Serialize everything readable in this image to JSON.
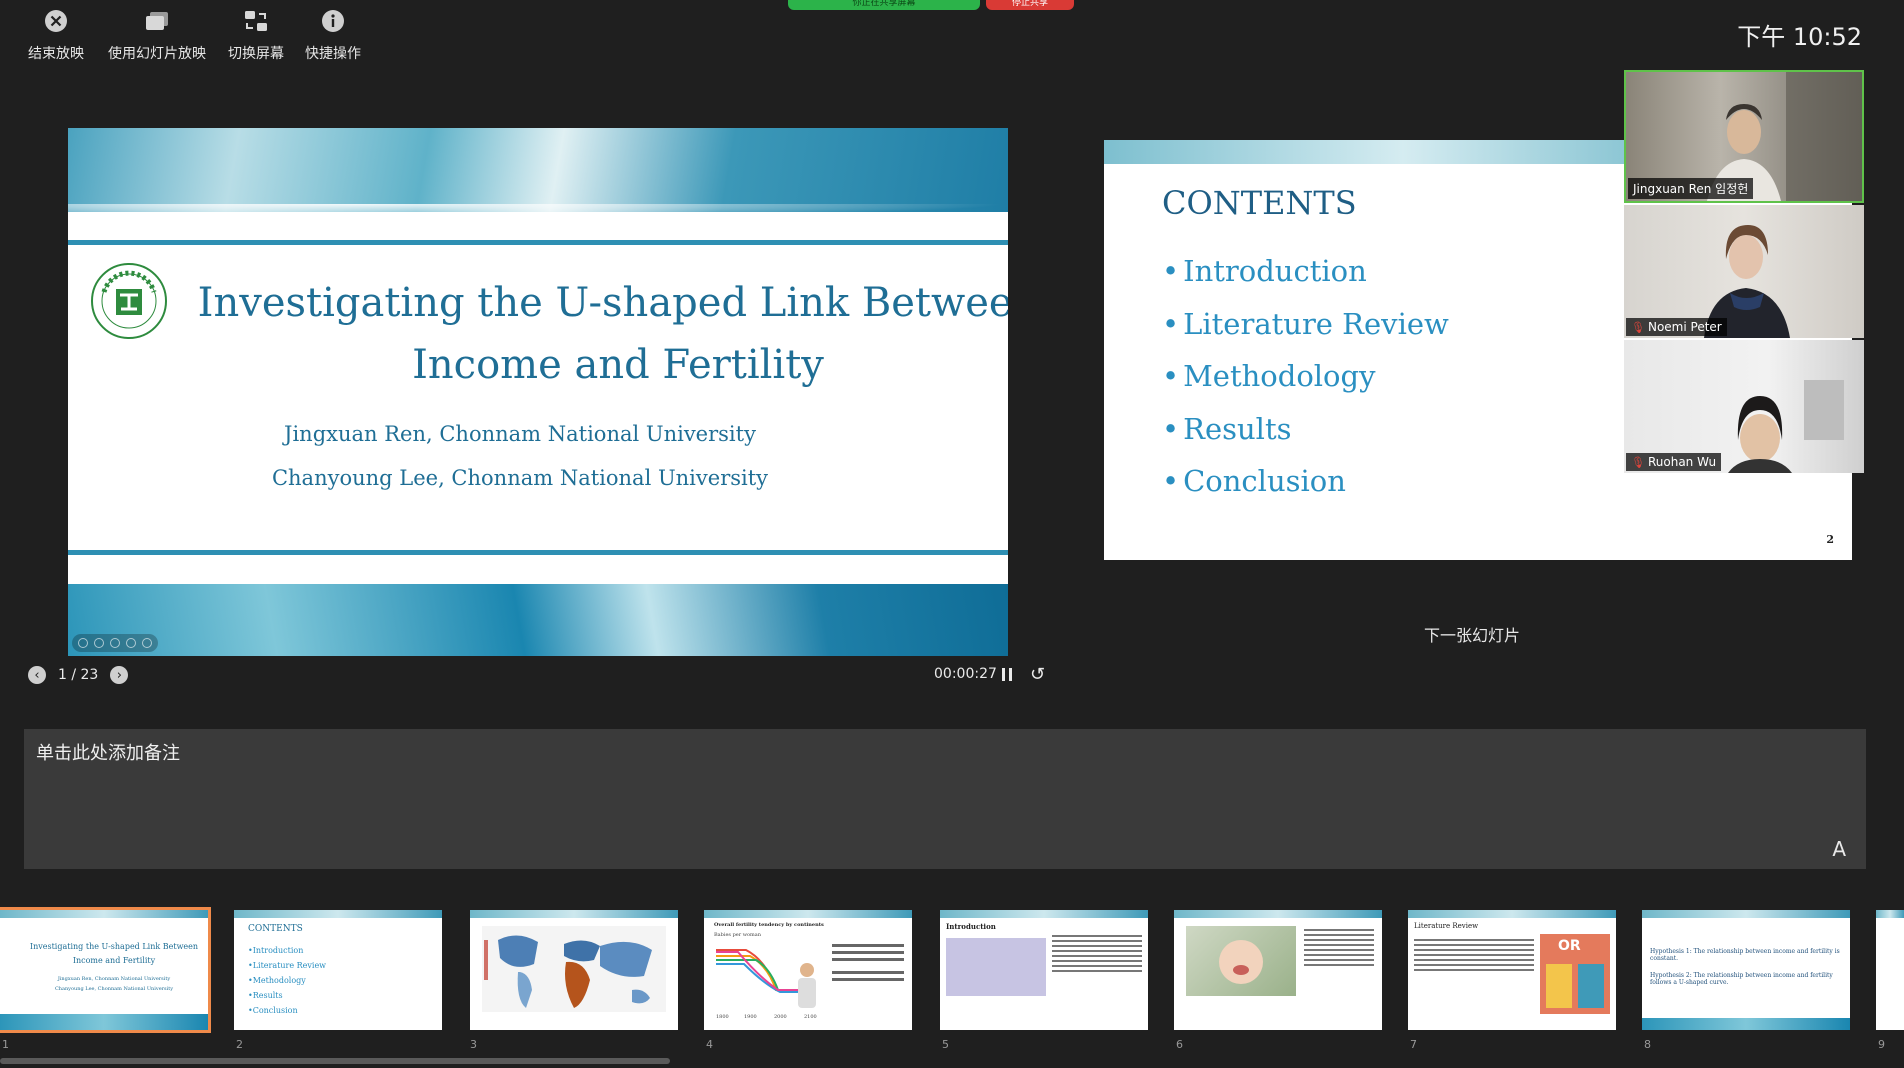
{
  "toolbar": {
    "end_show": "结束放映",
    "use_slideshow": "使用幻灯片放映",
    "switch_screen": "切换屏幕",
    "shortcuts": "快捷操作"
  },
  "share_bar": {
    "sharing": "你正在共享屏幕",
    "stop": "停止共享"
  },
  "clock": "下午 10:52",
  "current_slide": {
    "title": "Investigating the U-shaped Link Between Income and Fertility",
    "author1": "Jingxuan Ren, Chonnam National University",
    "author2": "Chanyoung Lee, Chonnam National University"
  },
  "navigation": {
    "counter": "1 / 23",
    "timer": "00:00:27"
  },
  "next_slide": {
    "label": "下一张幻灯片",
    "title": "CONTENTS",
    "items": [
      "Introduction",
      "Literature Review",
      "Methodology",
      "Results",
      "Conclusion"
    ],
    "page": "2"
  },
  "participants": [
    {
      "name": "Jingxuan Ren  임정헌"
    },
    {
      "name": "Noemi Peter"
    },
    {
      "name": "Ruohan Wu"
    }
  ],
  "notes": {
    "placeholder": "单击此处添加备注",
    "font_button": "A"
  },
  "thumbnails": [
    {
      "num": "1",
      "line1": "Investigating the U-shaped Link Between",
      "line2": "Income and Fertility",
      "line3": "Jingxuan Ren, Chonnam National University",
      "line4": "Chanyoung Lee, Chonnam National University"
    },
    {
      "num": "2",
      "title": "CONTENTS",
      "items": [
        "•Introduction",
        "•Literature Review",
        "•Methodology",
        "•Results",
        "•Conclusion"
      ]
    },
    {
      "num": "3"
    },
    {
      "num": "4",
      "title": "Overall fertility tendency by continents",
      "ylabel": "Babies per woman",
      "x1": "1800",
      "x2": "1900",
      "x3": "2000",
      "x4": "2100"
    },
    {
      "num": "5",
      "title": "Introduction"
    },
    {
      "num": "6"
    },
    {
      "num": "7",
      "title": "Literature Review",
      "badge": "OR"
    },
    {
      "num": "8",
      "h1": "Hypothesis 1: The relationship between income and fertility is constant.",
      "h2": "Hypothesis 2: The relationship between income and fertility follows a U-shaped curve."
    },
    {
      "num": "9"
    }
  ],
  "colors": {
    "background": "#1f1f1f",
    "slide_title": "#1f6e95",
    "selected_thumb": "#ef8a4a",
    "share_green": "#2cb34a",
    "share_red": "#d93a35",
    "active_speaker": "#5fc24a"
  }
}
